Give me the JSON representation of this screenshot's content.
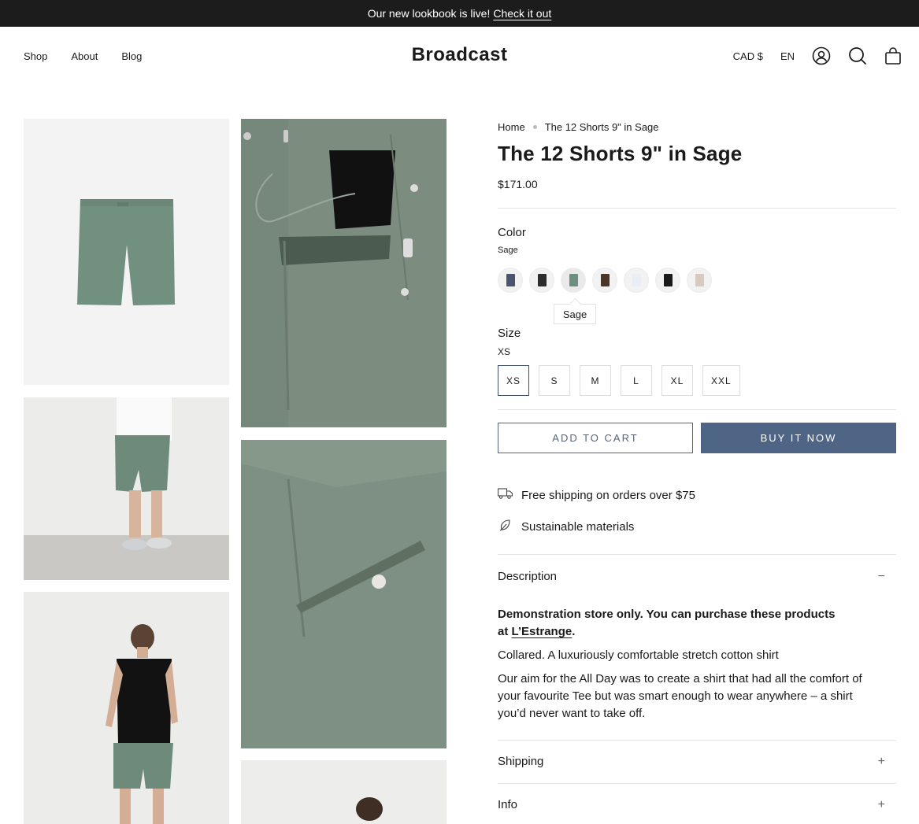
{
  "announcement": {
    "text": "Our new lookbook is live!",
    "link": "Check it out"
  },
  "nav": {
    "shop": "Shop",
    "about": "About",
    "blog": "Blog"
  },
  "brand": "Broadcast",
  "header_right": {
    "currency": "CAD $",
    "language": "EN",
    "icons": [
      "account-icon",
      "search-icon",
      "cart-icon"
    ]
  },
  "breadcrumb": {
    "home": "Home",
    "current": "The 12 Shorts 9\" in Sage"
  },
  "product": {
    "title": "The 12 Shorts 9\" in Sage",
    "price": "$171.00"
  },
  "color": {
    "label": "Color",
    "selected": "Sage",
    "tooltip": "Sage",
    "swatches": [
      "#4a5670",
      "#2d2d2d",
      "#6f9080",
      "#4a3526",
      "#e9eef5",
      "#1a1a1a",
      "#d8cbbd"
    ]
  },
  "size": {
    "label": "Size",
    "selected": "XS",
    "options": [
      "XS",
      "S",
      "M",
      "L",
      "XL",
      "XXL"
    ]
  },
  "buttons": {
    "add_to_cart": "ADD TO CART",
    "buy_now": "BUY IT NOW"
  },
  "perks": {
    "shipping": "Free shipping on orders over $75",
    "sustainable": "Sustainable materials"
  },
  "description": {
    "heading": "Description",
    "toggle": "−",
    "notice_pre": "Demonstration store only. You can purchase these products",
    "notice_at": "at",
    "notice_link": "L’Estrange",
    "notice_end": ".",
    "line1": "Collared. A luxuriously comfortable stretch cotton shirt",
    "para1": "Our aim for the All Day was to create a shirt that had all the comfort of",
    "para2": "your favourite Tee but was smart enough to wear anywhere – a shirt",
    "para3": "you’d never want to take off."
  },
  "shipping_acc": {
    "heading": "Shipping",
    "toggle": "+"
  },
  "info_acc": {
    "heading": "Info",
    "toggle": "+"
  },
  "colors": {
    "sage": "#6f8c7b",
    "button_blue": "#4f6585",
    "bar": "#1c1c1c"
  }
}
